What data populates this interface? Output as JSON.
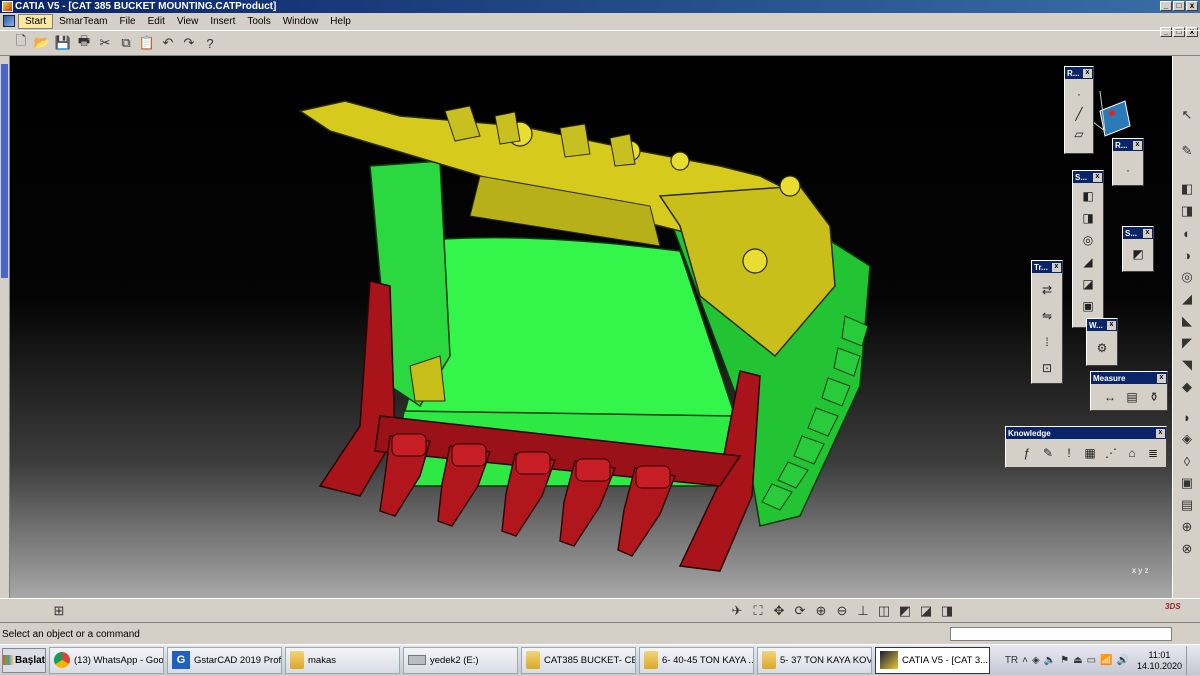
{
  "window": {
    "title": "CATIA V5 - [CAT 385 BUCKET MOUNTING.CATProduct]",
    "minimize": "_",
    "maximize": "□",
    "close": "x"
  },
  "menu": [
    "Start",
    "SmarTeam",
    "File",
    "Edit",
    "View",
    "Insert",
    "Tools",
    "Window",
    "Help"
  ],
  "toolbars": {
    "r1": "R...",
    "r2": "R...",
    "s1": "S...",
    "s2": "S...",
    "tr": "Tr...",
    "w": "W...",
    "measure": "Measure",
    "knowledge": "Knowledge",
    "close": "x"
  },
  "status": {
    "message": "Select an object or a command",
    "command_input": ""
  },
  "compass_label": "x y z",
  "taskbar": {
    "start": "Başlat",
    "tasks": [
      {
        "label": "(13) WhatsApp - Goo..."
      },
      {
        "label": "GstarCAD 2019 Prof..."
      },
      {
        "label": "makas"
      },
      {
        "label": "yedek2 (E:)"
      },
      {
        "label": "CAT385 BUCKET- CE..."
      },
      {
        "label": "6- 40-45 TON KAYA ..."
      },
      {
        "label": "5- 37 TON KAYA KOV..."
      },
      {
        "label": "CATIA V5 - [CAT 3..."
      }
    ],
    "lang": "TR",
    "time": "11:01",
    "date": "14.10.2020"
  },
  "colors": {
    "bucket_green": "#22d43a",
    "bucket_yellow": "#d4c81c",
    "teeth_red": "#a8141a"
  }
}
